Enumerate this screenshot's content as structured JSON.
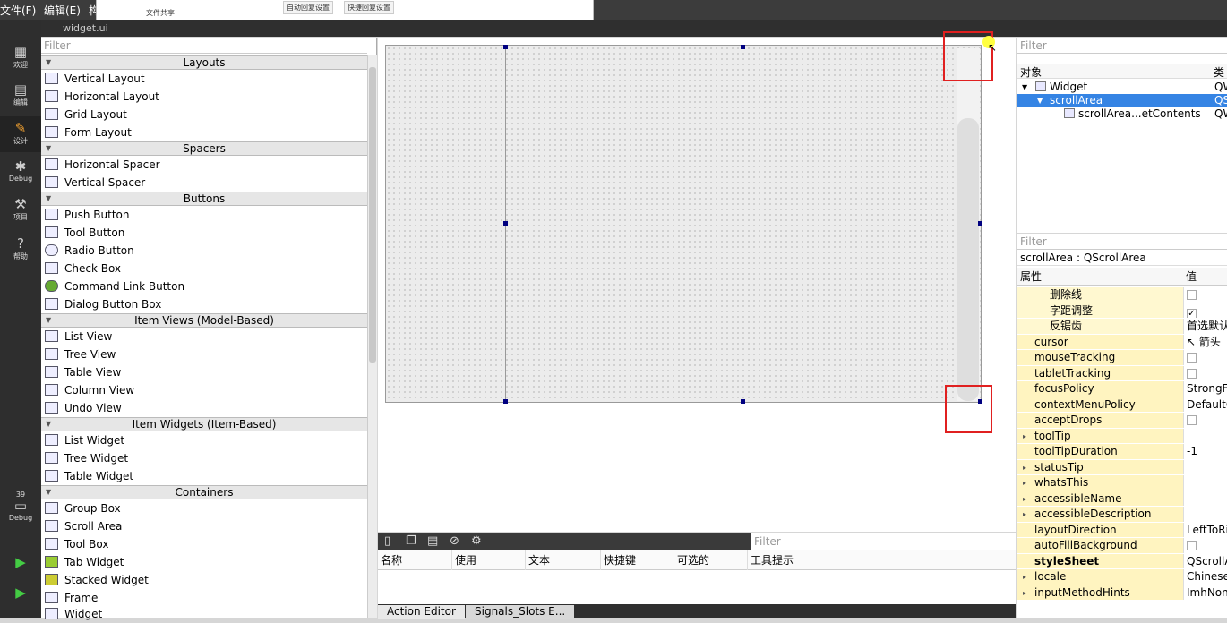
{
  "menubar": {
    "file": "文件(F)",
    "edit": "编辑(E)",
    "partial": "构"
  },
  "popup": {
    "label_share": "文件共享",
    "btn_auto": "自动回复设置",
    "btn_quick": "快捷回复设置"
  },
  "tabbar": {
    "title": "widget.ui"
  },
  "modes": [
    {
      "label": "欢迎",
      "icon": "grid-icon"
    },
    {
      "label": "编辑",
      "icon": "document-icon"
    },
    {
      "label": "设计",
      "icon": "pencil-icon"
    },
    {
      "label": "Debug",
      "icon": "bug-icon"
    },
    {
      "label": "项目",
      "icon": "wrench-icon"
    },
    {
      "label": "帮助",
      "icon": "help-icon"
    }
  ],
  "kit": {
    "number": "39",
    "label": "Debug"
  },
  "widgetbox": {
    "filter_placeholder": "Filter",
    "categories": {
      "layouts": "Layouts",
      "spacers": "Spacers",
      "buttons": "Buttons",
      "item_views": "Item Views (Model-Based)",
      "item_widgets": "Item Widgets (Item-Based)",
      "containers": "Containers"
    },
    "layouts": [
      "Vertical Layout",
      "Horizontal Layout",
      "Grid Layout",
      "Form Layout"
    ],
    "spacers": [
      "Horizontal Spacer",
      "Vertical Spacer"
    ],
    "buttons": [
      "Push Button",
      "Tool Button",
      "Radio Button",
      "Check Box",
      "Command Link Button",
      "Dialog Button Box"
    ],
    "item_views": [
      "List View",
      "Tree View",
      "Table View",
      "Column View",
      "Undo View"
    ],
    "item_widgets": [
      "List Widget",
      "Tree Widget",
      "Table Widget"
    ],
    "containers": [
      "Group Box",
      "Scroll Area",
      "Tool Box",
      "Tab Widget",
      "Stacked Widget",
      "Frame",
      "Widget"
    ]
  },
  "action_editor": {
    "filter_placeholder": "Filter",
    "columns": [
      "名称",
      "使用",
      "文本",
      "快捷键",
      "可选的",
      "工具提示"
    ],
    "tabs": [
      "Action Editor",
      "Signals_Slots E..."
    ]
  },
  "object_inspector": {
    "filter_placeholder": "Filter",
    "col_object": "对象",
    "col_class": "类",
    "rows": [
      {
        "name": "Widget",
        "class": "QW"
      },
      {
        "name": "scrollArea",
        "class": "QS"
      },
      {
        "name": "scrollArea...etContents",
        "class": "QW"
      }
    ]
  },
  "property_editor": {
    "filter_placeholder": "Filter",
    "title": "scrollArea : QScrollArea",
    "col_property": "属性",
    "col_value": "值",
    "rows": [
      {
        "name": "删除线",
        "value": "",
        "check": "off"
      },
      {
        "name": "字距调整",
        "value": "",
        "check": "on"
      },
      {
        "name": "反锯齿",
        "value": "首选默认"
      },
      {
        "name": "cursor",
        "value": "箭头"
      },
      {
        "name": "mouseTracking",
        "value": "",
        "check": "off"
      },
      {
        "name": "tabletTracking",
        "value": "",
        "check": "off"
      },
      {
        "name": "focusPolicy",
        "value": "StrongFo"
      },
      {
        "name": "contextMenuPolicy",
        "value": "DefaultC"
      },
      {
        "name": "acceptDrops",
        "value": "",
        "check": "off"
      },
      {
        "name": "toolTip",
        "value": ""
      },
      {
        "name": "toolTipDuration",
        "value": "-1"
      },
      {
        "name": "statusTip",
        "value": ""
      },
      {
        "name": "whatsThis",
        "value": ""
      },
      {
        "name": "accessibleName",
        "value": ""
      },
      {
        "name": "accessibleDescription",
        "value": ""
      },
      {
        "name": "layoutDirection",
        "value": "LeftToRi"
      },
      {
        "name": "autoFillBackground",
        "value": "",
        "check": "off"
      },
      {
        "name": "styleSheet",
        "value": "QScrollA"
      },
      {
        "name": "locale",
        "value": "Chinese,"
      },
      {
        "name": "inputMethodHints",
        "value": "ImhNone"
      }
    ]
  }
}
